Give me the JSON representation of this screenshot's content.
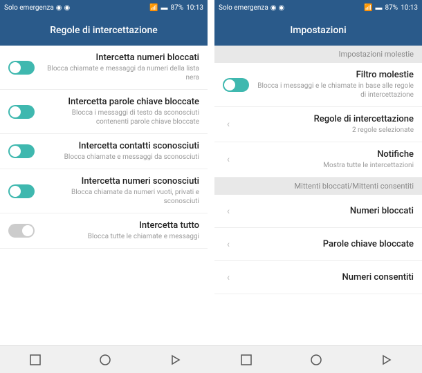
{
  "status": {
    "carrier": "Solo emergenza",
    "time": "10:13",
    "battery": "87%"
  },
  "left_phone": {
    "title": "Regole di intercettazione",
    "rows": [
      {
        "title": "Intercetta numeri bloccati",
        "subtitle": "Blocca chiamate e messaggi da numeri della lista nera",
        "toggle": true
      },
      {
        "title": "Intercetta parole chiave bloccate",
        "subtitle": "Blocca i messaggi di testo da sconosciuti contenenti parole chiave bloccate",
        "toggle": true
      },
      {
        "title": "Intercetta contatti sconosciuti",
        "subtitle": "Blocca chiamate e messaggi da sconosciuti",
        "toggle": true
      },
      {
        "title": "Intercetta numeri sconosciuti",
        "subtitle": "Blocca chiamate da numeri vuoti, privati e sconosciuti",
        "toggle": true
      },
      {
        "title": "Intercetta tutto",
        "subtitle": "Blocca tutte le chiamate e messaggi",
        "toggle": false
      }
    ]
  },
  "right_phone": {
    "title": "Impostazioni",
    "sections": [
      {
        "header": "Impostazioni molestie"
      },
      {
        "row": {
          "title": "Filtro molestie",
          "subtitle": "Blocca i messaggi e le chiamate in base alle regole di intercettazione",
          "type": "toggle",
          "toggle": true
        }
      },
      {
        "row": {
          "title": "Regole di intercettazione",
          "subtitle": "2 regole selezionate",
          "type": "chevron"
        }
      },
      {
        "row": {
          "title": "Notifiche",
          "subtitle": "Mostra tutte le intercettazioni",
          "type": "chevron"
        }
      },
      {
        "header": "Mittenti bloccati/Mittenti consentiti"
      },
      {
        "row": {
          "title": "Numeri bloccati",
          "type": "chevron"
        }
      },
      {
        "row": {
          "title": "Parole chiave bloccate",
          "type": "chevron"
        }
      },
      {
        "row": {
          "title": "Numeri consentiti",
          "type": "chevron"
        }
      }
    ]
  }
}
